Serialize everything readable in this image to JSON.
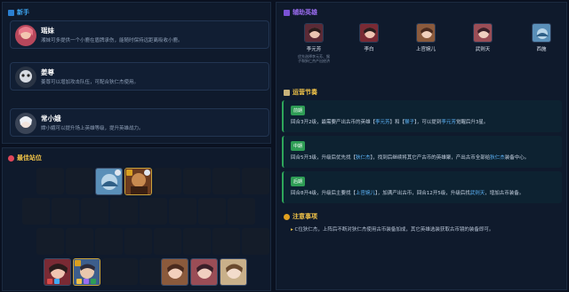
{
  "newbie": {
    "title": "新手",
    "heroes": [
      {
        "name": "瑶妹",
        "desc": "湘妹可多提供一个小鹿在盾牌承伤，能随时保持远距离吸收小鹿。"
      },
      {
        "name": "姜尊",
        "desc": "姜尊可以增加攻击队伍，可配合狄仁杰使用。"
      },
      {
        "name": "常小娥",
        "desc": "嫦小娥可以提升场上英雄等级，提升英雄战力。"
      }
    ]
  },
  "board": {
    "title": "最佳站位"
  },
  "assist": {
    "title": "辅助英雄",
    "heroes": [
      {
        "name": "李元芳",
        "desc": "优先选择李元芳、猴子和狄仁杰产出经济"
      },
      {
        "name": "李白",
        "desc": ""
      },
      {
        "name": "上官婉儿",
        "desc": ""
      },
      {
        "name": "武则天",
        "desc": ""
      },
      {
        "name": "西施",
        "desc": ""
      }
    ]
  },
  "rhythm": {
    "title": "运营节奏",
    "items": [
      {
        "tag": "前期",
        "text_a": "回合3开2级，最需要产出古币的英雄【",
        "hl1": "李元芳",
        "text_b": "】和【",
        "hl2": "猴子",
        "text_c": "】，可以提到",
        "hl3": "李元芳",
        "text_d": "觉醒后升3星。"
      },
      {
        "tag": "中期",
        "text_a": "回合5开3级，升级后优先找【",
        "hl1": "狄仁杰",
        "text_b": "】，找到后继续将其它产古币的英雄聚，产出古币全部给",
        "hl2": "狄仁杰",
        "text_c": "装备中心。",
        "hl3": "",
        "text_d": ""
      },
      {
        "tag": "后期",
        "text_a": "回合8开4级，升级后主要找【",
        "hl1": "上官婉儿",
        "text_b": "】，加满产出古币，回合12开5级，升级后找",
        "hl2": "武则天",
        "text_c": "，增加古币装备。",
        "hl3": "",
        "text_d": ""
      }
    ]
  },
  "notice": {
    "title": "注意事项",
    "lines": [
      "C位狄仁杰，上阵后不断对狄仁杰使用古币装备加成，其它英雄选装获取古币镜的装备即可。"
    ]
  },
  "colors": {
    "accent_blue": "#3fa9f5",
    "accent_green": "#2e9d55",
    "accent_gold": "#f1c348",
    "accent_purple": "#9a6cf0"
  }
}
